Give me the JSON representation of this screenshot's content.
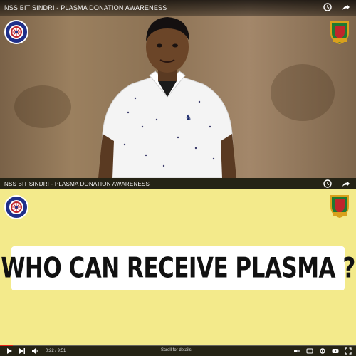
{
  "top_frame": {
    "title": "NSS BIT SINDRI - PLASMA DONATION AWARENESS",
    "icons": [
      "clock-icon",
      "share-icon"
    ]
  },
  "bottom_frame": {
    "title": "NSS BIT SINDRI - PLASMA DONATION AWARENESS",
    "question": "WHO CAN RECEIVE PLASMA ?",
    "icons": [
      "clock-icon",
      "share-icon"
    ]
  },
  "player": {
    "time": "0:22 / 9:51",
    "progress": 0.037,
    "scroll_hint": "Scroll for details",
    "accent_color": "#e62117"
  },
  "colors": {
    "question_bg": "#f3ea8b",
    "card_bg": "#ffffff",
    "nss_logo": "#1f2f8a"
  }
}
